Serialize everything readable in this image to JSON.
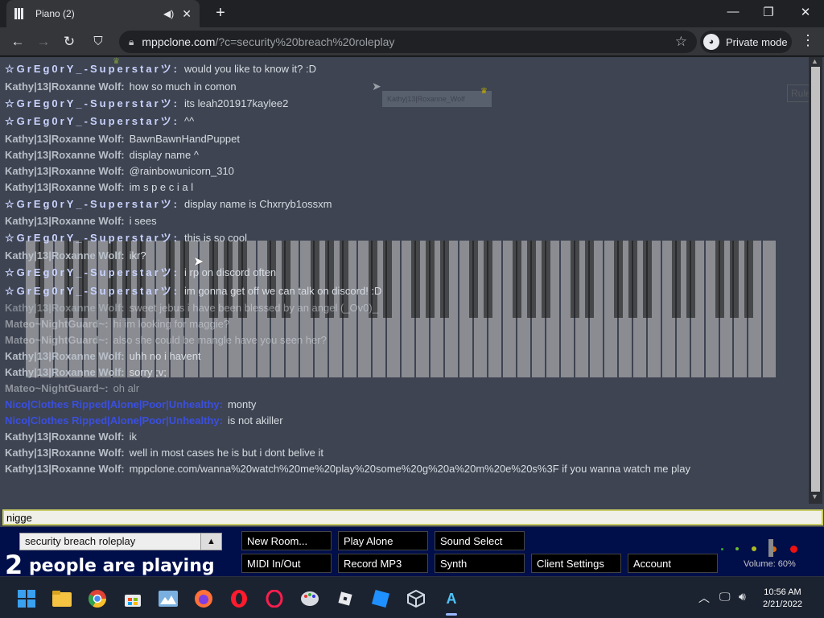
{
  "browser": {
    "tab_title": "Piano (2)",
    "new_tab": "+",
    "url_domain": "mppclone.com",
    "url_rest": "/?c=security%20breach%20roleplay",
    "private_mode": "Private mode"
  },
  "room": {
    "tag_label": "Kathy|13|Roxanne_Wolf",
    "rules_label": "Rule"
  },
  "chat": [
    {
      "name": "☆GrEg0rY_-Superstarツ:",
      "text": "would you like to know it? :D",
      "color": "#c9d3ff",
      "big": true
    },
    {
      "name": "Kathy|13|Roxanne Wolf:",
      "text": "how so much in comon",
      "color": "#b8bfc8"
    },
    {
      "name": "☆GrEg0rY_-Superstarツ:",
      "text": "its leah201917kaylee2",
      "color": "#c9d3ff",
      "big": true
    },
    {
      "name": "☆GrEg0rY_-Superstarツ:",
      "text": "^^",
      "color": "#c9d3ff",
      "big": true
    },
    {
      "name": "Kathy|13|Roxanne Wolf:",
      "text": "BawnBawnHandPuppet",
      "color": "#b8bfc8"
    },
    {
      "name": "Kathy|13|Roxanne Wolf:",
      "text": "display name ^",
      "color": "#b8bfc8"
    },
    {
      "name": "Kathy|13|Roxanne Wolf:",
      "text": "@rainbowunicorn_310",
      "color": "#b8bfc8"
    },
    {
      "name": "Kathy|13|Roxanne Wolf:",
      "text": "im s p e c i a l",
      "color": "#b8bfc8"
    },
    {
      "name": "☆GrEg0rY_-Superstarツ:",
      "text": "display name is Chxrryb1ossxm",
      "color": "#c9d3ff",
      "big": true
    },
    {
      "name": "Kathy|13|Roxanne Wolf:",
      "text": "i sees",
      "color": "#b8bfc8"
    },
    {
      "name": "☆GrEg0rY_-Superstarツ:",
      "text": "this is so cool",
      "color": "#c9d3ff",
      "big": true
    },
    {
      "name": "Kathy|13|Roxanne Wolf:",
      "text": "ikr?",
      "color": "#b8bfc8"
    },
    {
      "name": "☆GrEg0rY_-Superstarツ:",
      "text": "i rp on discord often",
      "color": "#c9d3ff",
      "big": true
    },
    {
      "name": "☆GrEg0rY_-Superstarツ:",
      "text": "im gonna get off we can talk on discord! :D",
      "color": "#c9d3ff",
      "big": true
    },
    {
      "name": "Kathy|13|Roxanne Wolf:",
      "text": "sweet jebus i have been blessed by an angel (_Ov0)_",
      "color": "#b8bfc8",
      "faded": true
    },
    {
      "name": "Mateo~NightGuard~:",
      "text": "hi im looking for maggie?",
      "color": "#d0d4da",
      "faded": true
    },
    {
      "name": "Mateo~NightGuard~:",
      "text": "also she could be mangle have you seen her?",
      "color": "#d0d4da",
      "faded": true
    },
    {
      "name": "Kathy|13|Roxanne Wolf:",
      "text": "uhh no i havent",
      "color": "#b8bfc8"
    },
    {
      "name": "Kathy|13|Roxanne Wolf:",
      "text": "sorry ;v;",
      "color": "#b8bfc8"
    },
    {
      "name": "Mateo~NightGuard~:",
      "text": "oh alr",
      "color": "#d0d4da",
      "faded": true
    },
    {
      "name": "Nico|Clothes Ripped|Alone|Poor|Unhealthy:",
      "text": "monty",
      "color": "#3a4fe0"
    },
    {
      "name": "Nico|Clothes Ripped|Alone|Poor|Unhealthy:",
      "text": "is not akiller",
      "color": "#3a4fe0"
    },
    {
      "name": "Kathy|13|Roxanne Wolf:",
      "text": "ik",
      "color": "#b8bfc8"
    },
    {
      "name": "Kathy|13|Roxanne Wolf:",
      "text": "well in most cases he is but i dont belive it",
      "color": "#b8bfc8"
    },
    {
      "name": "Kathy|13|Roxanne Wolf:",
      "text": "mppclone.com/wanna%20watch%20me%20play%20some%20g%20a%20m%20e%20s%3F if you wanna watch me play",
      "color": "#b8bfc8",
      "wrap": true
    }
  ],
  "chat_input": {
    "value": "nigge"
  },
  "bottom": {
    "room_name": "security breach roleplay",
    "players_num": "2",
    "players_text": "people are playing",
    "buttons": [
      "New Room...",
      "Play Alone",
      "Sound Select",
      "MIDI In/Out",
      "Record MP3",
      "Synth",
      "Client Settings",
      "Account"
    ],
    "volume": "Volume: 60%"
  },
  "taskbar": {
    "time": "10:56 AM",
    "date": "2/21/2022"
  }
}
